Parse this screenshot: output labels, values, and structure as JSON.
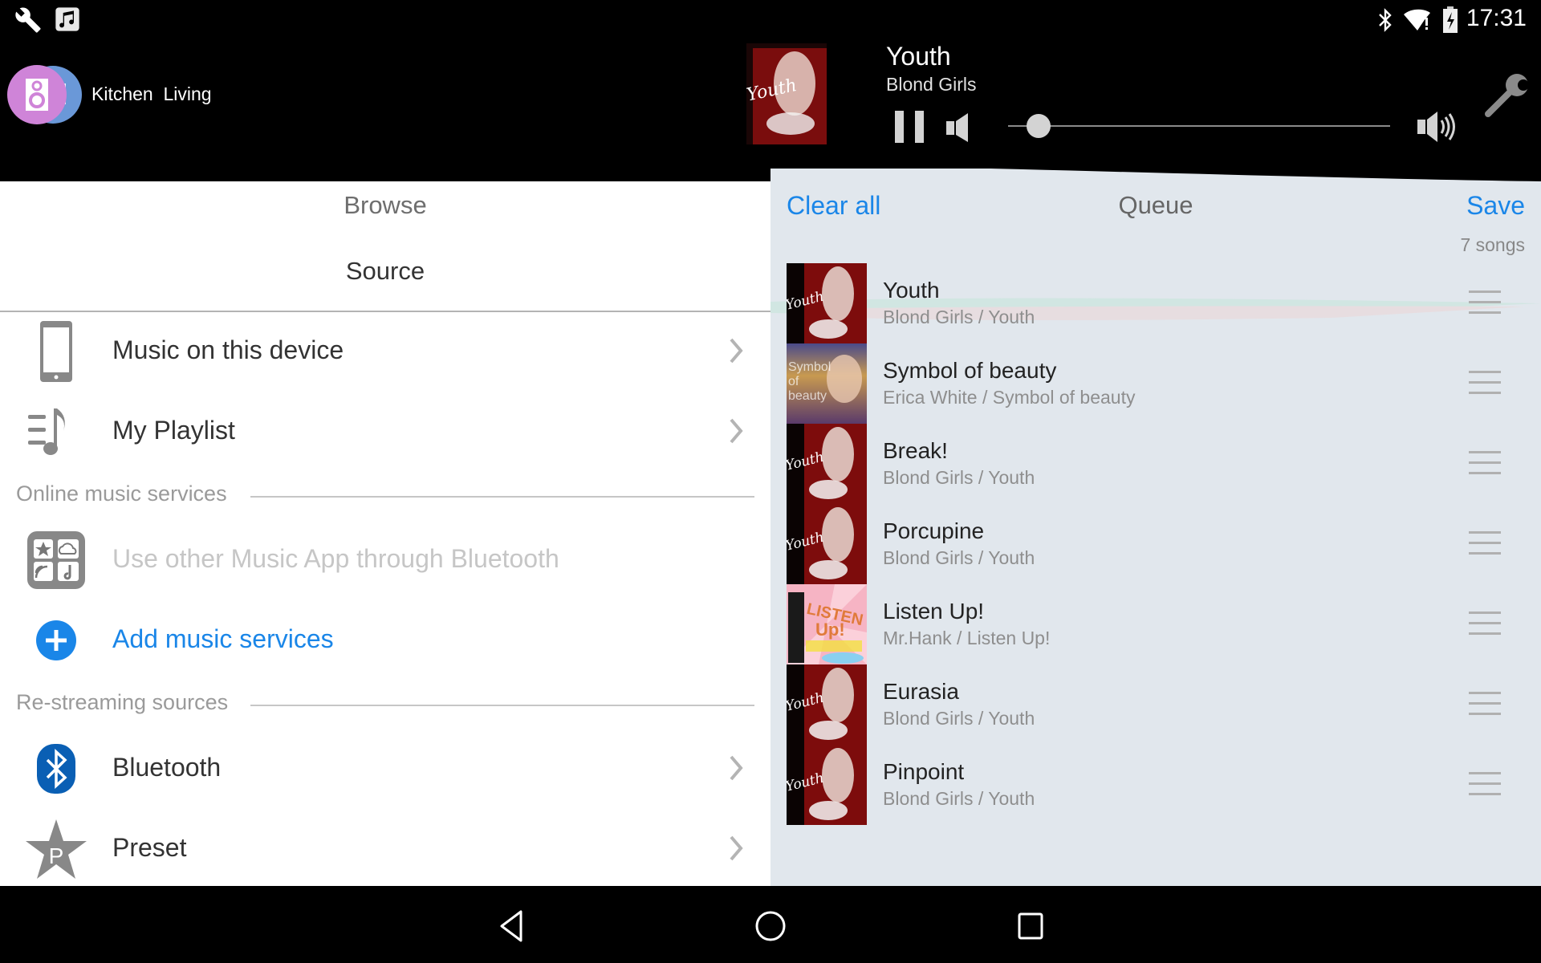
{
  "status_bar": {
    "left_icons": [
      "wrench-icon",
      "music-note-icon"
    ],
    "right_icons": [
      "bluetooth-icon",
      "wifi-alert-icon",
      "battery-charging-icon"
    ],
    "time": "17:31"
  },
  "header": {
    "rooms": "Kitchen  Living",
    "now_playing": {
      "title": "Youth",
      "artist": "Blond Girls",
      "album_art": "Youth"
    },
    "controls": {
      "pause": "pause-icon",
      "mute": "speaker-mute-icon",
      "volume_max": "speaker-loud-icon",
      "settings": "wrench-icon"
    },
    "volume_percent": 8
  },
  "browse": {
    "title": "Browse",
    "subtitle": "Source",
    "items": [
      {
        "label": "Music on this device",
        "icon": "phone-icon",
        "chevron": true
      },
      {
        "label": "My Playlist",
        "icon": "playlist-icon",
        "chevron": true
      }
    ],
    "sections": [
      {
        "title": "Online music services",
        "items": [
          {
            "label": "Use other Music App through Bluetooth",
            "icon": "music-apps-icon",
            "disabled": true
          },
          {
            "label": "Add music services",
            "icon": "add-circle-icon",
            "link": true
          }
        ]
      },
      {
        "title": "Re-streaming sources",
        "items": [
          {
            "label": "Bluetooth",
            "icon": "bluetooth-icon",
            "chevron": true
          },
          {
            "label": "Preset",
            "icon": "preset-star-icon",
            "chevron": true
          }
        ]
      }
    ]
  },
  "queue": {
    "clear_label": "Clear all",
    "title": "Queue",
    "save_label": "Save",
    "count": "7 songs",
    "songs": [
      {
        "title": "Youth",
        "subtitle": "Blond Girls / Youth",
        "art": "youth"
      },
      {
        "title": "Symbol of beauty",
        "subtitle": "Erica White / Symbol of beauty",
        "art": "symbol"
      },
      {
        "title": "Break!",
        "subtitle": "Blond Girls / Youth",
        "art": "youth"
      },
      {
        "title": "Porcupine",
        "subtitle": "Blond Girls / Youth",
        "art": "youth"
      },
      {
        "title": "Listen Up!",
        "subtitle": "Mr.Hank / Listen Up!",
        "art": "listenup"
      },
      {
        "title": "Eurasia",
        "subtitle": "Blond Girls / Youth",
        "art": "youth"
      },
      {
        "title": "Pinpoint",
        "subtitle": "Blond Girls / Youth",
        "art": "youth"
      }
    ]
  },
  "nav_bar": {
    "back": "back-icon",
    "home": "home-icon",
    "recents": "recents-icon"
  },
  "colors": {
    "accent": "#1a86e8",
    "queue_bg": "#e1e7ed",
    "header_bg": "#000000"
  }
}
